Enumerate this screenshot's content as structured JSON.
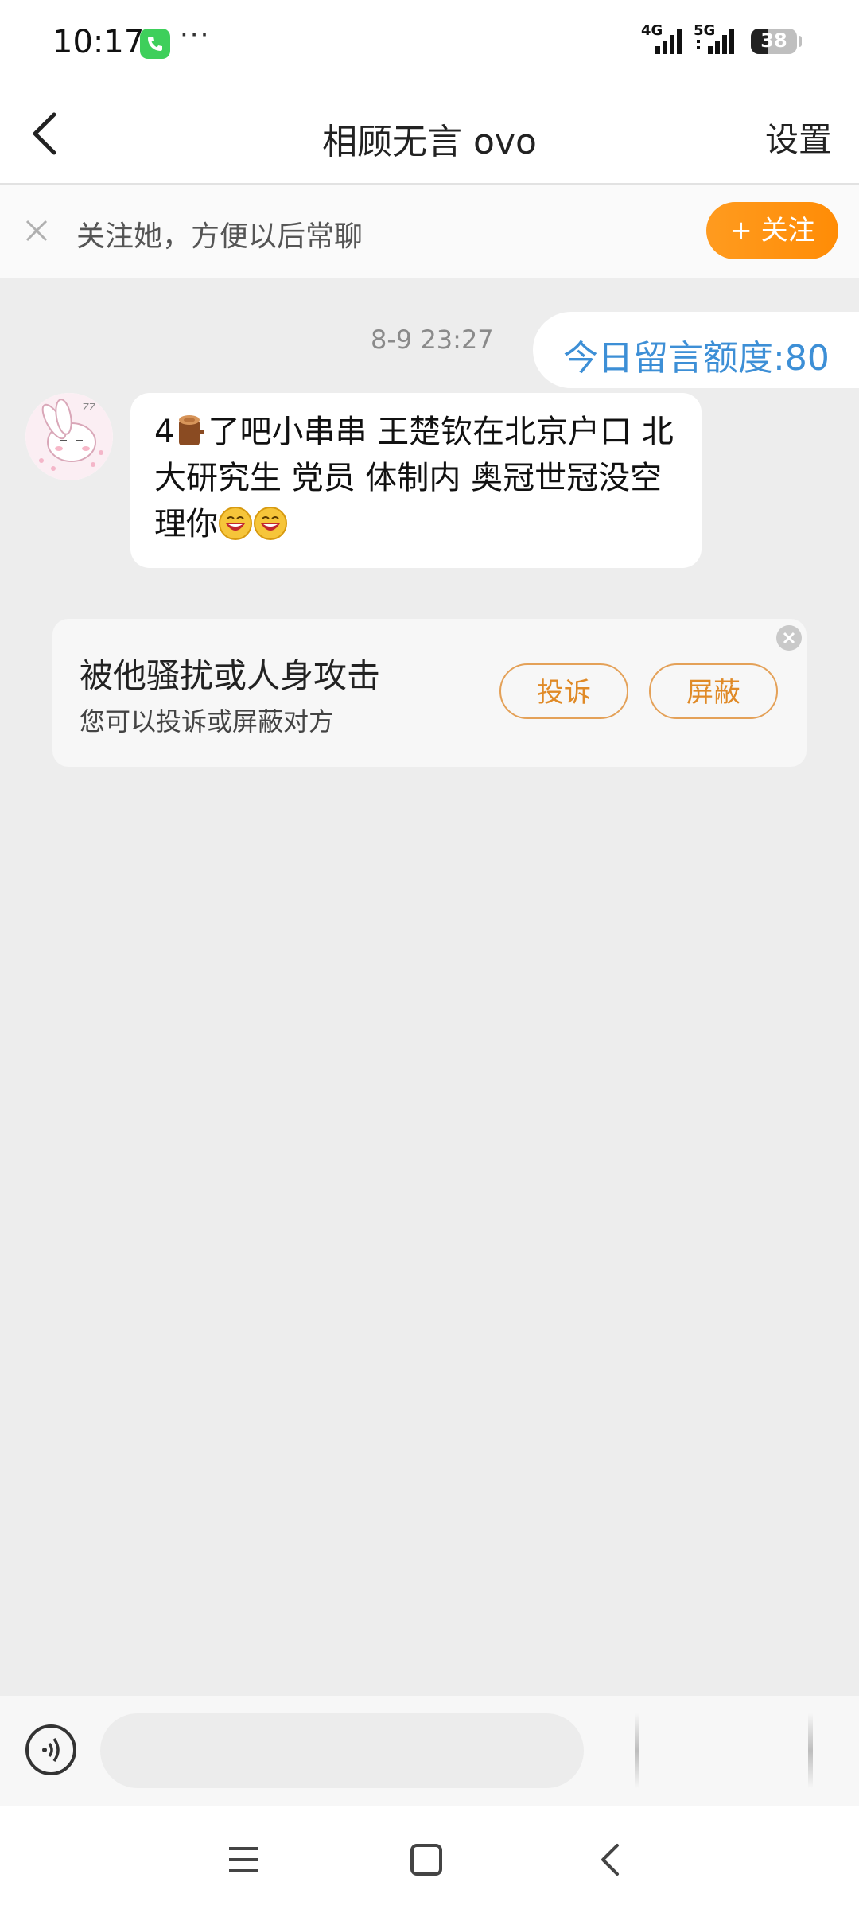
{
  "status_bar": {
    "time": "10:17",
    "more": "···",
    "signal_1": "4G",
    "signal_2": "5G",
    "battery": "38"
  },
  "nav": {
    "title": "相顾无言 ovo",
    "settings_label": "设置",
    "back_icon": "chevron-left-icon"
  },
  "follow_bar": {
    "text": "关注她，方便以后常聊",
    "button_label": "+ 关注"
  },
  "chat": {
    "timestamp": "8-9 23:27",
    "quota": "今日留言额度:80",
    "messages": [
      {
        "sender": "other",
        "text_part1": "4",
        "text_part2": "了吧小串串 王楚钦在北京户口 北大研究生 党员 体制内 奥冠世冠没空理你"
      }
    ]
  },
  "report_card": {
    "title": "被他骚扰或人身攻击",
    "subtitle": "您可以投诉或屏蔽对方",
    "complain_label": "投诉",
    "block_label": "屏蔽"
  },
  "input_bar": {
    "placeholder": ""
  },
  "colors": {
    "accent_orange": "#ff8c06",
    "quota_blue": "#3d8fd6",
    "chat_bg": "#ededed"
  }
}
